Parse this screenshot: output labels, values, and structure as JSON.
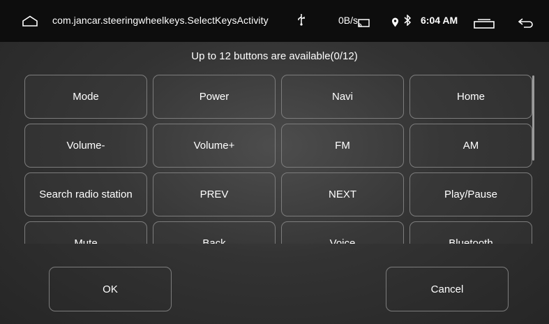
{
  "status_bar": {
    "icons": [
      "home-outline-icon",
      "usb-icon",
      "cast-icon",
      "location-icon",
      "bluetooth-icon",
      "recents-icon",
      "back-icon"
    ],
    "app_title": "com.jancar.steeringwheelkeys.SelectKeysActivity",
    "net_speed": "0B/s",
    "time": "6:04 AM"
  },
  "subtitle": "Up to 12 buttons are available(0/12)",
  "keys": [
    "Mode",
    "Power",
    "Navi",
    "Home",
    "Volume-",
    "Volume+",
    "FM",
    "AM",
    "Search radio station",
    "PREV",
    "NEXT",
    "Play/Pause",
    "Mute",
    "Back",
    "Voice",
    "Bluetooth"
  ],
  "actions": {
    "ok_label": "OK",
    "cancel_label": "Cancel"
  }
}
